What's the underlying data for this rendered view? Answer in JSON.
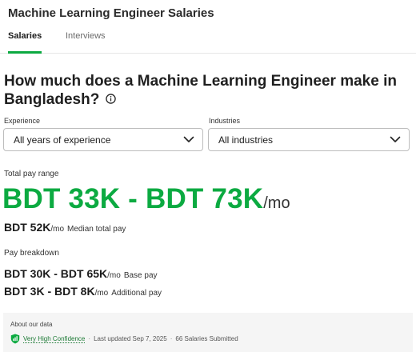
{
  "header": {
    "title": "Machine Learning Engineer Salaries"
  },
  "tabs": [
    {
      "label": "Salaries",
      "active": true
    },
    {
      "label": "Interviews",
      "active": false
    }
  ],
  "question": {
    "text": "How much does a Machine Learning Engineer make in Bangladesh?"
  },
  "filters": {
    "experience": {
      "label": "Experience",
      "value": "All years of experience"
    },
    "industries": {
      "label": "Industries",
      "value": "All industries"
    }
  },
  "total_pay": {
    "label": "Total pay range",
    "range": "BDT 33K - BDT 73K",
    "unit": "/mo",
    "median": "BDT 52K",
    "median_unit": "/mo",
    "median_label": "Median total pay"
  },
  "breakdown": {
    "label": "Pay breakdown",
    "base": {
      "range": "BDT 30K - BDT 65K",
      "unit": "/mo",
      "label": "Base pay"
    },
    "additional": {
      "range": "BDT 3K - BDT 8K",
      "unit": "/mo",
      "label": "Additional pay"
    }
  },
  "about": {
    "title": "About our data",
    "confidence": "Very High Confidence",
    "separator": "·",
    "updated": "Last updated Sep 7, 2025",
    "submitted": "66 Salaries Submitted"
  },
  "colors": {
    "accent": "#0caa41",
    "confidence": "#1c7a35"
  }
}
